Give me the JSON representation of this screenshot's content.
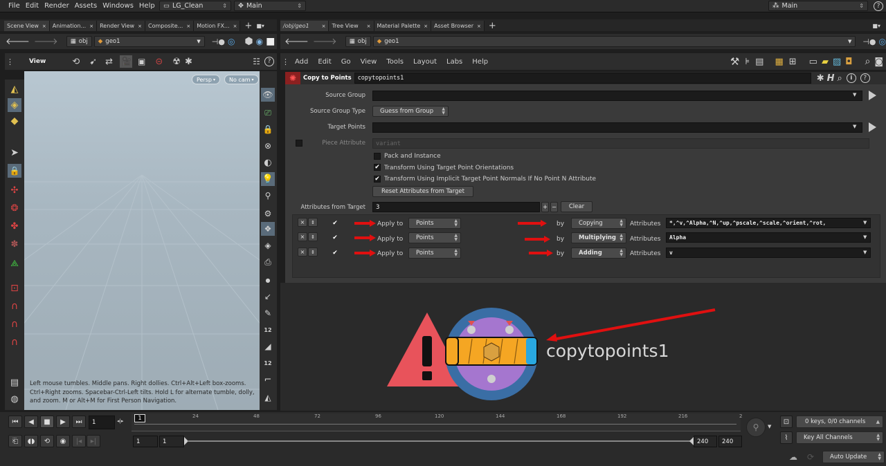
{
  "menubar": {
    "items": [
      "File",
      "Edit",
      "Render",
      "Assets",
      "Windows",
      "Help"
    ],
    "desktop": "LG_Clean",
    "context": "Main",
    "right_desktop": "Main"
  },
  "left_tabs": [
    "Scene View",
    "Animation...",
    "Render View",
    "Composite...",
    "Motion FX..."
  ],
  "right_tabs": [
    "/obj/geo1",
    "Tree View",
    "Material Palette",
    "Asset Browser"
  ],
  "left_path": {
    "crumb1": "obj",
    "crumb2": "geo1"
  },
  "right_path": {
    "crumb1": "obj",
    "crumb2": "geo1"
  },
  "viewport": {
    "menu_label": "View",
    "persp": "Persp",
    "cam": "No cam",
    "hint_lines": [
      "Left mouse tumbles. Middle pans. Right dollies. Ctrl+Alt+Left box-zooms.",
      "Ctrl+Right zooms. Spacebar-Ctrl-Left tilts. Hold L for alternate tumble, dolly,",
      "and zoom.     M or Alt+M for First Person Navigation."
    ]
  },
  "network_menu": [
    "Add",
    "Edit",
    "Go",
    "View",
    "Tools",
    "Layout",
    "Labs",
    "Help"
  ],
  "node": {
    "type": "Copy to Points",
    "name": "copytopoints1"
  },
  "params": {
    "source_group_label": "Source Group",
    "source_group_type_label": "Source Group Type",
    "source_group_type_value": "Guess from Group",
    "target_points_label": "Target Points",
    "piece_attribute_label": "Piece Attribute",
    "piece_attribute_value": "variant",
    "pack_instance": "Pack and Instance",
    "transform_orient": "Transform Using Target Point Orientations",
    "transform_normals": "Transform Using Implicit Target Point Normals If No Point N Attribute",
    "reset_button": "Reset Attributes from Target",
    "attrs_from_target_label": "Attributes from Target",
    "attrs_from_target_value": "3",
    "clear_button": "Clear",
    "rows": [
      {
        "apply_label": "Apply to",
        "apply_value": "Points",
        "by_label": "by",
        "by_value": "Copying",
        "attr_label": "Attributes",
        "attr_value": "*,^v,^Alpha,^N,^up,^pscale,^scale,^orient,^rot,"
      },
      {
        "apply_label": "Apply to",
        "apply_value": "Points",
        "by_label": "by",
        "by_value": "Multiplying",
        "attr_label": "Attributes",
        "attr_value": "Alpha"
      },
      {
        "apply_label": "Apply to",
        "apply_value": "Points",
        "by_label": "by",
        "by_value": "Adding",
        "attr_label": "Attributes",
        "attr_value": "v"
      }
    ]
  },
  "network_node_label": "copytopoints1",
  "timeline": {
    "current_frame": "1",
    "frame_marker": "1",
    "ticks": [
      "24",
      "48",
      "72",
      "96",
      "120",
      "144",
      "168",
      "192",
      "216",
      "2"
    ],
    "start1": "1",
    "start2": "1",
    "end1": "240",
    "end2": "240",
    "keys_channels": "0 keys, 0/0 channels",
    "key_all": "Key All Channels",
    "auto_update": "Auto Update"
  },
  "colors": {
    "accent_red": "#e01010",
    "node_orange": "#f5a623",
    "node_blue": "#29a8e0",
    "warn_red": "#e8535b"
  }
}
